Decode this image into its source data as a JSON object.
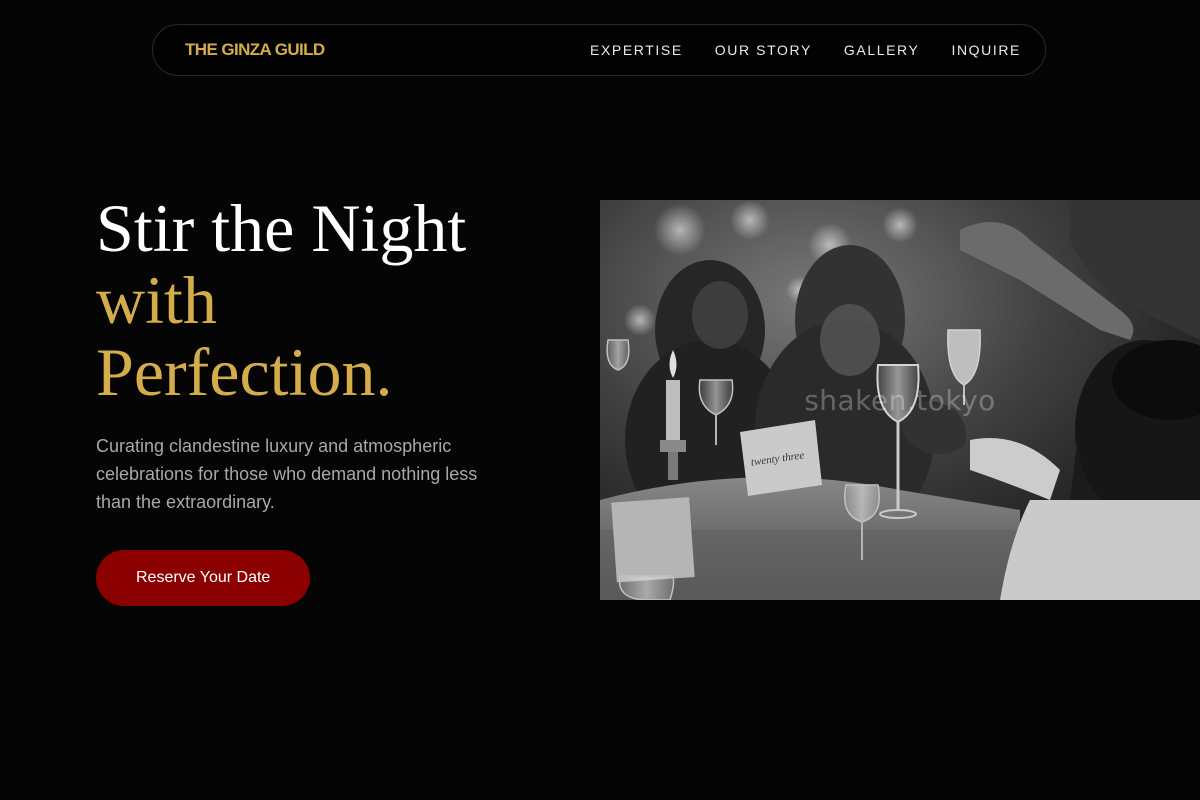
{
  "nav": {
    "brand": "THE GINZA GUILD",
    "links": [
      "EXPERTISE",
      "OUR STORY",
      "GALLERY",
      "INQUIRE"
    ]
  },
  "hero": {
    "headline_line1": "Stir the Night",
    "headline_line2": "with",
    "headline_line3": "Perfection.",
    "subcopy": "Curating clandestine luxury and atmospheric celebrations for those who demand nothing less than the extraordinary.",
    "cta_label": "Reserve Your Date",
    "image": {
      "watermark": "shaken.tokyo",
      "place_card_text": "twenty three"
    }
  },
  "colors": {
    "background": "#050505",
    "gold": "#d4ad4a",
    "cta": "#8b0000",
    "subtext": "#a7a7ad"
  }
}
